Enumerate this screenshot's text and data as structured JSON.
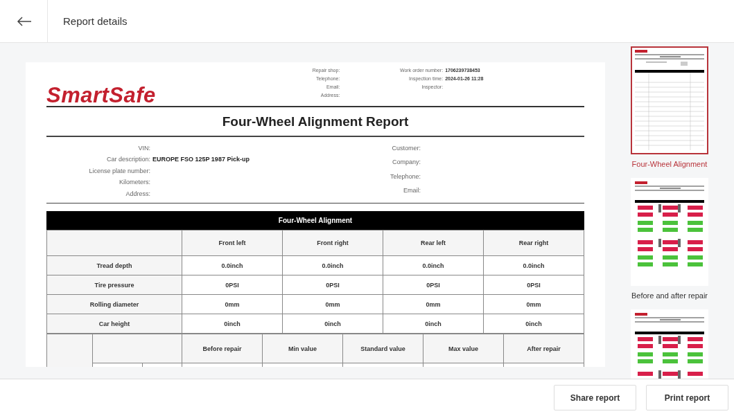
{
  "header": {
    "title": "Report details"
  },
  "report": {
    "logo": "SmartSafe",
    "shop_info": [
      {
        "label": "Repair shop:"
      },
      {
        "label": "Telephone:"
      },
      {
        "label": "Email:"
      },
      {
        "label": "Address:"
      }
    ],
    "order_info": [
      {
        "label": "Work order number:",
        "value": "1706239738453"
      },
      {
        "label": "Inspection time:",
        "value": "2024-01-26 11:28"
      },
      {
        "label": "Inspector:"
      }
    ],
    "title": "Four-Wheel Alignment Report",
    "vehicle_info": [
      {
        "label": "VIN:"
      },
      {
        "label": "Car description:",
        "value": "EUROPE FSO 125P 1987 Pick-up"
      },
      {
        "label": "License plate number:"
      },
      {
        "label": "Kilometers:"
      },
      {
        "label": "Address:"
      }
    ],
    "customer_info": [
      {
        "label": "Customer:"
      },
      {
        "label": "Company:"
      },
      {
        "label": "Telephone:"
      },
      {
        "label": "Email:"
      }
    ],
    "alignment_table": {
      "title": "Four-Wheel Alignment",
      "columns": [
        "Front left",
        "Front right",
        "Rear left",
        "Rear right"
      ],
      "rows": [
        {
          "label": "Tread depth",
          "values": [
            "0.0inch",
            "0.0inch",
            "0.0inch",
            "0.0inch"
          ]
        },
        {
          "label": "Tire pressure",
          "values": [
            "0PSI",
            "0PSI",
            "0PSI",
            "0PSI"
          ]
        },
        {
          "label": "Rolling diameter",
          "values": [
            "0mm",
            "0mm",
            "0mm",
            "0mm"
          ]
        },
        {
          "label": "Car height",
          "values": [
            "0inch",
            "0inch",
            "0inch",
            "0inch"
          ]
        }
      ]
    },
    "repair_table": {
      "columns": [
        "Before repair",
        "Min value",
        "Standard value",
        "Max value",
        "After repair"
      ]
    }
  },
  "thumbnails": [
    {
      "kind": "table",
      "label": "Four-Wheel Alignment",
      "selected": true
    },
    {
      "kind": "wheels",
      "label": "Before and after repair",
      "selected": false
    },
    {
      "kind": "wheels",
      "selected": false
    }
  ],
  "buttons": [
    "Share report",
    "Print report"
  ]
}
